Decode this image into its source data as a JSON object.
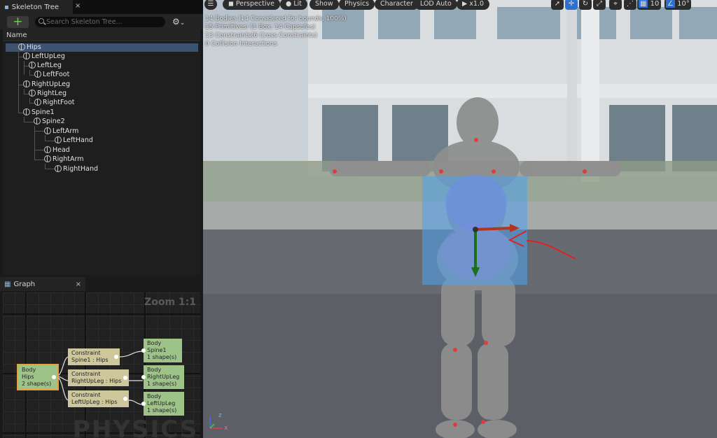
{
  "skeleton_tree": {
    "tab_title": "Skeleton Tree",
    "close_label": "×",
    "search_placeholder": "Search Skeleton Tree...",
    "column_header": "Name",
    "bones": [
      "Hips",
      "LeftUpLeg",
      "LeftLeg",
      "LeftFoot",
      "RightUpLeg",
      "RightLeg",
      "RightFoot",
      "Spine1",
      "Spine2",
      "LeftArm",
      "LeftHand",
      "Head",
      "RightArm",
      "RightHand"
    ]
  },
  "graph": {
    "tab_title": "Graph",
    "close_label": "×",
    "zoom": "Zoom 1:1",
    "watermark": "PHYSICS",
    "nodes": {
      "body_hips": [
        "Body",
        "Hips",
        "2 shape(s)"
      ],
      "constraint_spine1": [
        "Constraint",
        "Spine1 : Hips"
      ],
      "constraint_rightupleg": [
        "Constraint",
        "RightUpLeg : Hips"
      ],
      "constraint_leftupleg": [
        "Constraint",
        "LeftUpLeg : Hips"
      ],
      "body_spine1": [
        "Body",
        "Spine1",
        "1 shape(s)"
      ],
      "body_rightupleg": [
        "Body",
        "RightUpLeg",
        "1 shape(s)"
      ],
      "body_leftupleg": [
        "Body",
        "LeftUpLeg",
        "1 shape(s)"
      ]
    }
  },
  "viewport": {
    "toolbar": {
      "perspective": "Perspective",
      "lit": "Lit",
      "show": "Show",
      "physics": "Physics",
      "character": "Character",
      "lod": "LOD Auto",
      "play_speed": "x1.0",
      "grid_snap": "10",
      "rot_snap": "10°"
    },
    "stats": [
      "14 Bodies (14 Considered for bounds, 100%)",
      "15 Primitives: (1 Box, 14 Capsules)",
      "13 Constraints(6 Cross Constraints)",
      "0 Collision Interactions"
    ],
    "axis_labels": [
      "z",
      "x"
    ]
  }
}
